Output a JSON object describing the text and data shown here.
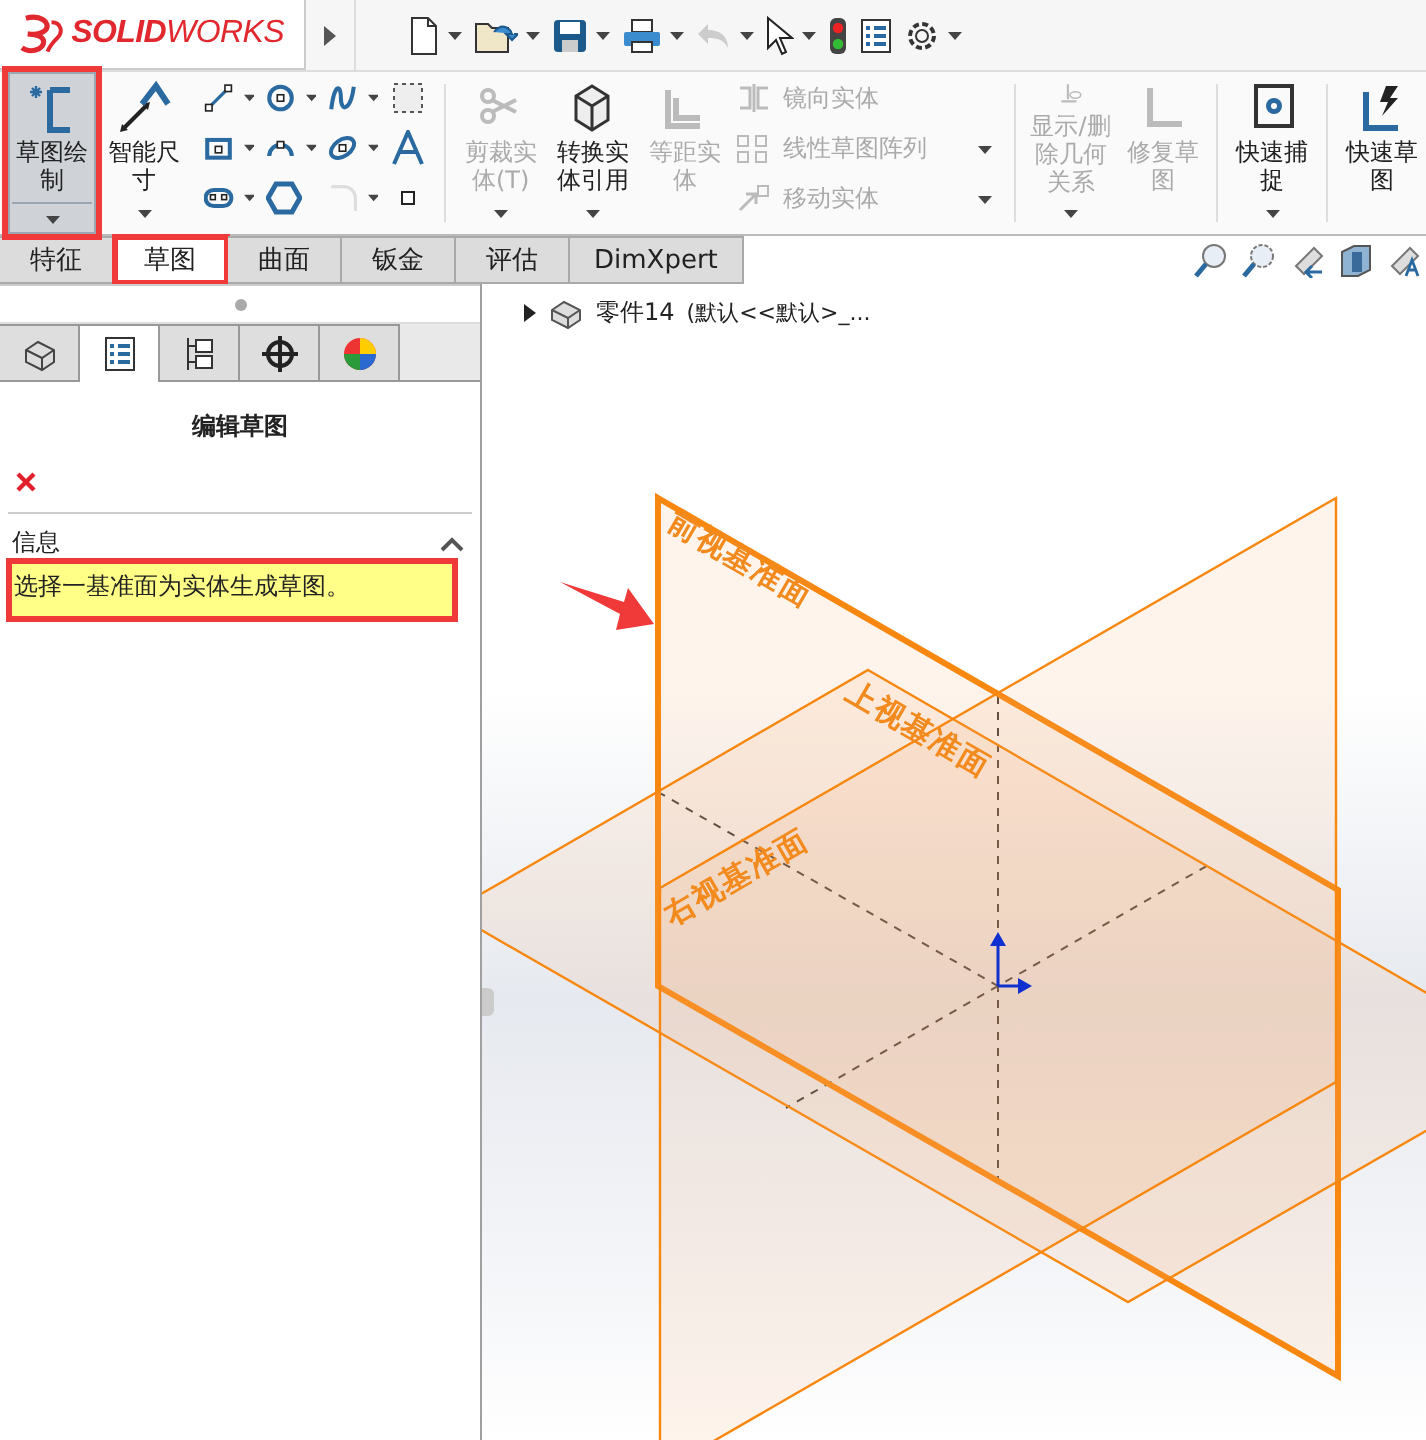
{
  "logo": "**SOLID**WORKS",
  "ribbon": [
    {
      "kind": "large",
      "label": "草图绘制",
      "selected": true,
      "disabled": false,
      "dropdown": true,
      "highlighted": true
    },
    {
      "kind": "large",
      "label": "智能尺寸",
      "selected": false,
      "disabled": false,
      "dropdown": true,
      "highlighted": false
    },
    {
      "kind": "tools",
      "items": [
        {
          "dropdown": true,
          "disabled": false
        },
        {
          "dropdown": true,
          "disabled": false
        },
        {
          "dropdown": true,
          "disabled": false
        },
        {
          "dropdown": false,
          "disabled": false
        },
        {
          "dropdown": true,
          "disabled": false
        },
        {
          "dropdown": true,
          "disabled": false
        },
        {
          "dropdown": true,
          "disabled": false
        },
        {
          "dropdown": false,
          "disabled": false
        },
        {
          "dropdown": true,
          "disabled": false
        },
        {
          "dropdown": false,
          "disabled": false
        },
        {
          "dropdown": true,
          "disabled": true
        },
        {
          "dropdown": false,
          "disabled": false
        }
      ]
    },
    {
      "kind": "separator"
    },
    {
      "kind": "large",
      "label": "剪裁实体(T)",
      "selected": false,
      "disabled": true,
      "dropdown": true,
      "highlighted": false
    },
    {
      "kind": "large",
      "label": "转换实体引用",
      "selected": false,
      "disabled": false,
      "dropdown": true,
      "highlighted": false
    },
    {
      "kind": "large",
      "label": "等距实体",
      "selected": false,
      "disabled": true,
      "dropdown": false,
      "highlighted": false
    },
    {
      "kind": "list",
      "items": [
        {
          "label": "镜向实体",
          "disabled": true,
          "dropdown": false
        },
        {
          "label": "线性草图阵列",
          "disabled": true,
          "dropdown": true
        },
        {
          "label": "移动实体",
          "disabled": true,
          "dropdown": true
        }
      ]
    },
    {
      "kind": "separator"
    },
    {
      "kind": "large",
      "label": "显示/删除几何关系",
      "selected": false,
      "disabled": true,
      "dropdown": true,
      "highlighted": false
    },
    {
      "kind": "large",
      "label": "修复草图",
      "selected": false,
      "disabled": true,
      "dropdown": false,
      "highlighted": false
    },
    {
      "kind": "separator"
    },
    {
      "kind": "large",
      "label": "快速捕捉",
      "selected": false,
      "disabled": false,
      "dropdown": true,
      "highlighted": false
    },
    {
      "kind": "separator"
    },
    {
      "kind": "large",
      "label": "快速草图",
      "selected": false,
      "disabled": false,
      "dropdown": false,
      "highlighted": false
    }
  ],
  "tabs": [
    {
      "label": "特征",
      "selected": false,
      "highlighted": false
    },
    {
      "label": "草图",
      "selected": true,
      "highlighted": true
    },
    {
      "label": "曲面",
      "selected": false,
      "highlighted": false
    },
    {
      "label": "钣金",
      "selected": false,
      "highlighted": false
    },
    {
      "label": "评估",
      "selected": false,
      "highlighted": false
    },
    {
      "label": "DimXpert",
      "selected": false,
      "highlighted": false
    }
  ],
  "panel": {
    "tabs": [
      {
        "selected": false
      },
      {
        "selected": true
      },
      {
        "selected": false
      },
      {
        "selected": false
      },
      {
        "selected": false
      }
    ],
    "title": "编辑草图",
    "section": {
      "title": "信息",
      "expanded": true,
      "message": "选择一基准面为实体生成草图。",
      "highlighted": true
    }
  },
  "viewport": {
    "tree": {
      "expanded": false,
      "part": "零件14",
      "config": "(默认<<默认>_..."
    },
    "planes": [
      {
        "label": "前视基准面"
      },
      {
        "label": "上视基准面"
      },
      {
        "label": "右视基准面"
      }
    ],
    "callout_arrow": true
  }
}
